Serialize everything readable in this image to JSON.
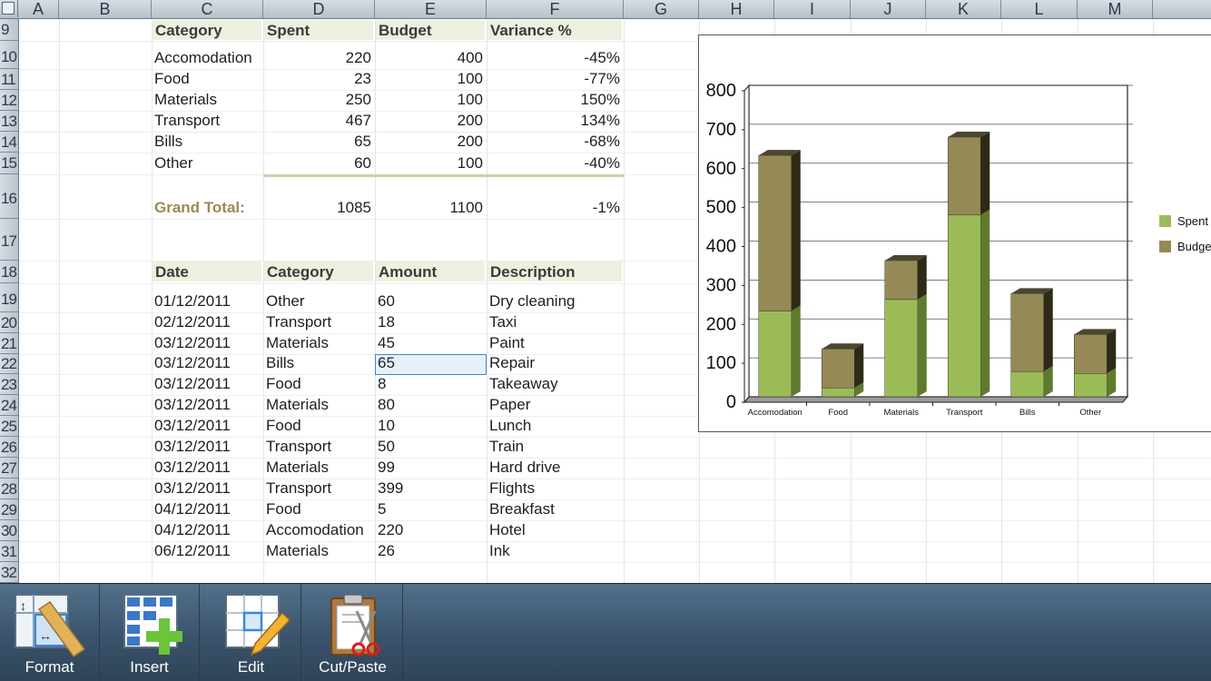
{
  "columns": [
    "A",
    "B",
    "C",
    "D",
    "E",
    "F",
    "G",
    "H",
    "I",
    "J",
    "K",
    "L",
    "M"
  ],
  "rows": [
    "9",
    "10",
    "11",
    "12",
    "13",
    "14",
    "15",
    "16",
    "17",
    "18",
    "19",
    "20",
    "21",
    "22",
    "23",
    "24",
    "25",
    "26",
    "27",
    "28",
    "29",
    "30",
    "31",
    "32"
  ],
  "summary": {
    "headers": [
      "Category",
      "Spent",
      "Budget",
      "Variance %"
    ],
    "rows": [
      [
        "Accomodation",
        "220",
        "400",
        "-45%"
      ],
      [
        "Food",
        "23",
        "100",
        "-77%"
      ],
      [
        "Materials",
        "250",
        "100",
        "150%"
      ],
      [
        "Transport",
        "467",
        "200",
        "134%"
      ],
      [
        "Bills",
        "65",
        "200",
        "-68%"
      ],
      [
        "Other",
        "60",
        "100",
        "-40%"
      ]
    ],
    "total": {
      "label": "Grand Total:",
      "spent": "1085",
      "budget": "1100",
      "variance": "-1%"
    }
  },
  "expenses": {
    "headers": [
      "Date",
      "Category",
      "Amount",
      "Description"
    ],
    "rows": [
      [
        "01/12/2011",
        "Other",
        "60",
        "Dry cleaning"
      ],
      [
        "02/12/2011",
        "Transport",
        "18",
        "Taxi"
      ],
      [
        "03/12/2011",
        "Materials",
        "45",
        "Paint"
      ],
      [
        "03/12/2011",
        "Bills",
        "65",
        "Repair"
      ],
      [
        "03/12/2011",
        "Food",
        "8",
        "Takeaway"
      ],
      [
        "03/12/2011",
        "Materials",
        "80",
        "Paper"
      ],
      [
        "03/12/2011",
        "Food",
        "10",
        "Lunch"
      ],
      [
        "03/12/2011",
        "Transport",
        "50",
        "Train"
      ],
      [
        "03/12/2011",
        "Materials",
        "99",
        "Hard drive"
      ],
      [
        "03/12/2011",
        "Transport",
        "399",
        "Flights"
      ],
      [
        "04/12/2011",
        "Food",
        "5",
        "Breakfast"
      ],
      [
        "04/12/2011",
        "Accomodation",
        "220",
        "Hotel"
      ],
      [
        "06/12/2011",
        "Materials",
        "26",
        "Ink"
      ]
    ]
  },
  "chart_data": {
    "type": "bar",
    "stacked": true,
    "categories": [
      "Accomodation",
      "Food",
      "Materials",
      "Transport",
      "Bills",
      "Other"
    ],
    "series": [
      {
        "name": "Spent",
        "values": [
          220,
          23,
          250,
          467,
          65,
          60
        ],
        "color": "#9bbb59"
      },
      {
        "name": "Budget",
        "values": [
          400,
          100,
          100,
          200,
          200,
          100
        ],
        "color": "#958a55"
      }
    ],
    "ylim": [
      0,
      800
    ],
    "yticks": [
      "0",
      "100",
      "200",
      "300",
      "400",
      "500",
      "600",
      "700",
      "800"
    ],
    "grid": true,
    "legend": "right",
    "legend_labels": [
      "Spent",
      "Budge"
    ]
  },
  "toolbar": {
    "buttons": [
      {
        "label": "Format",
        "icon": "ruler-format-icon"
      },
      {
        "label": "Insert",
        "icon": "insert-grid-icon"
      },
      {
        "label": "Edit",
        "icon": "pencil-edit-icon"
      },
      {
        "label": "Cut/Paste",
        "icon": "clipboard-scissors-icon"
      }
    ]
  }
}
